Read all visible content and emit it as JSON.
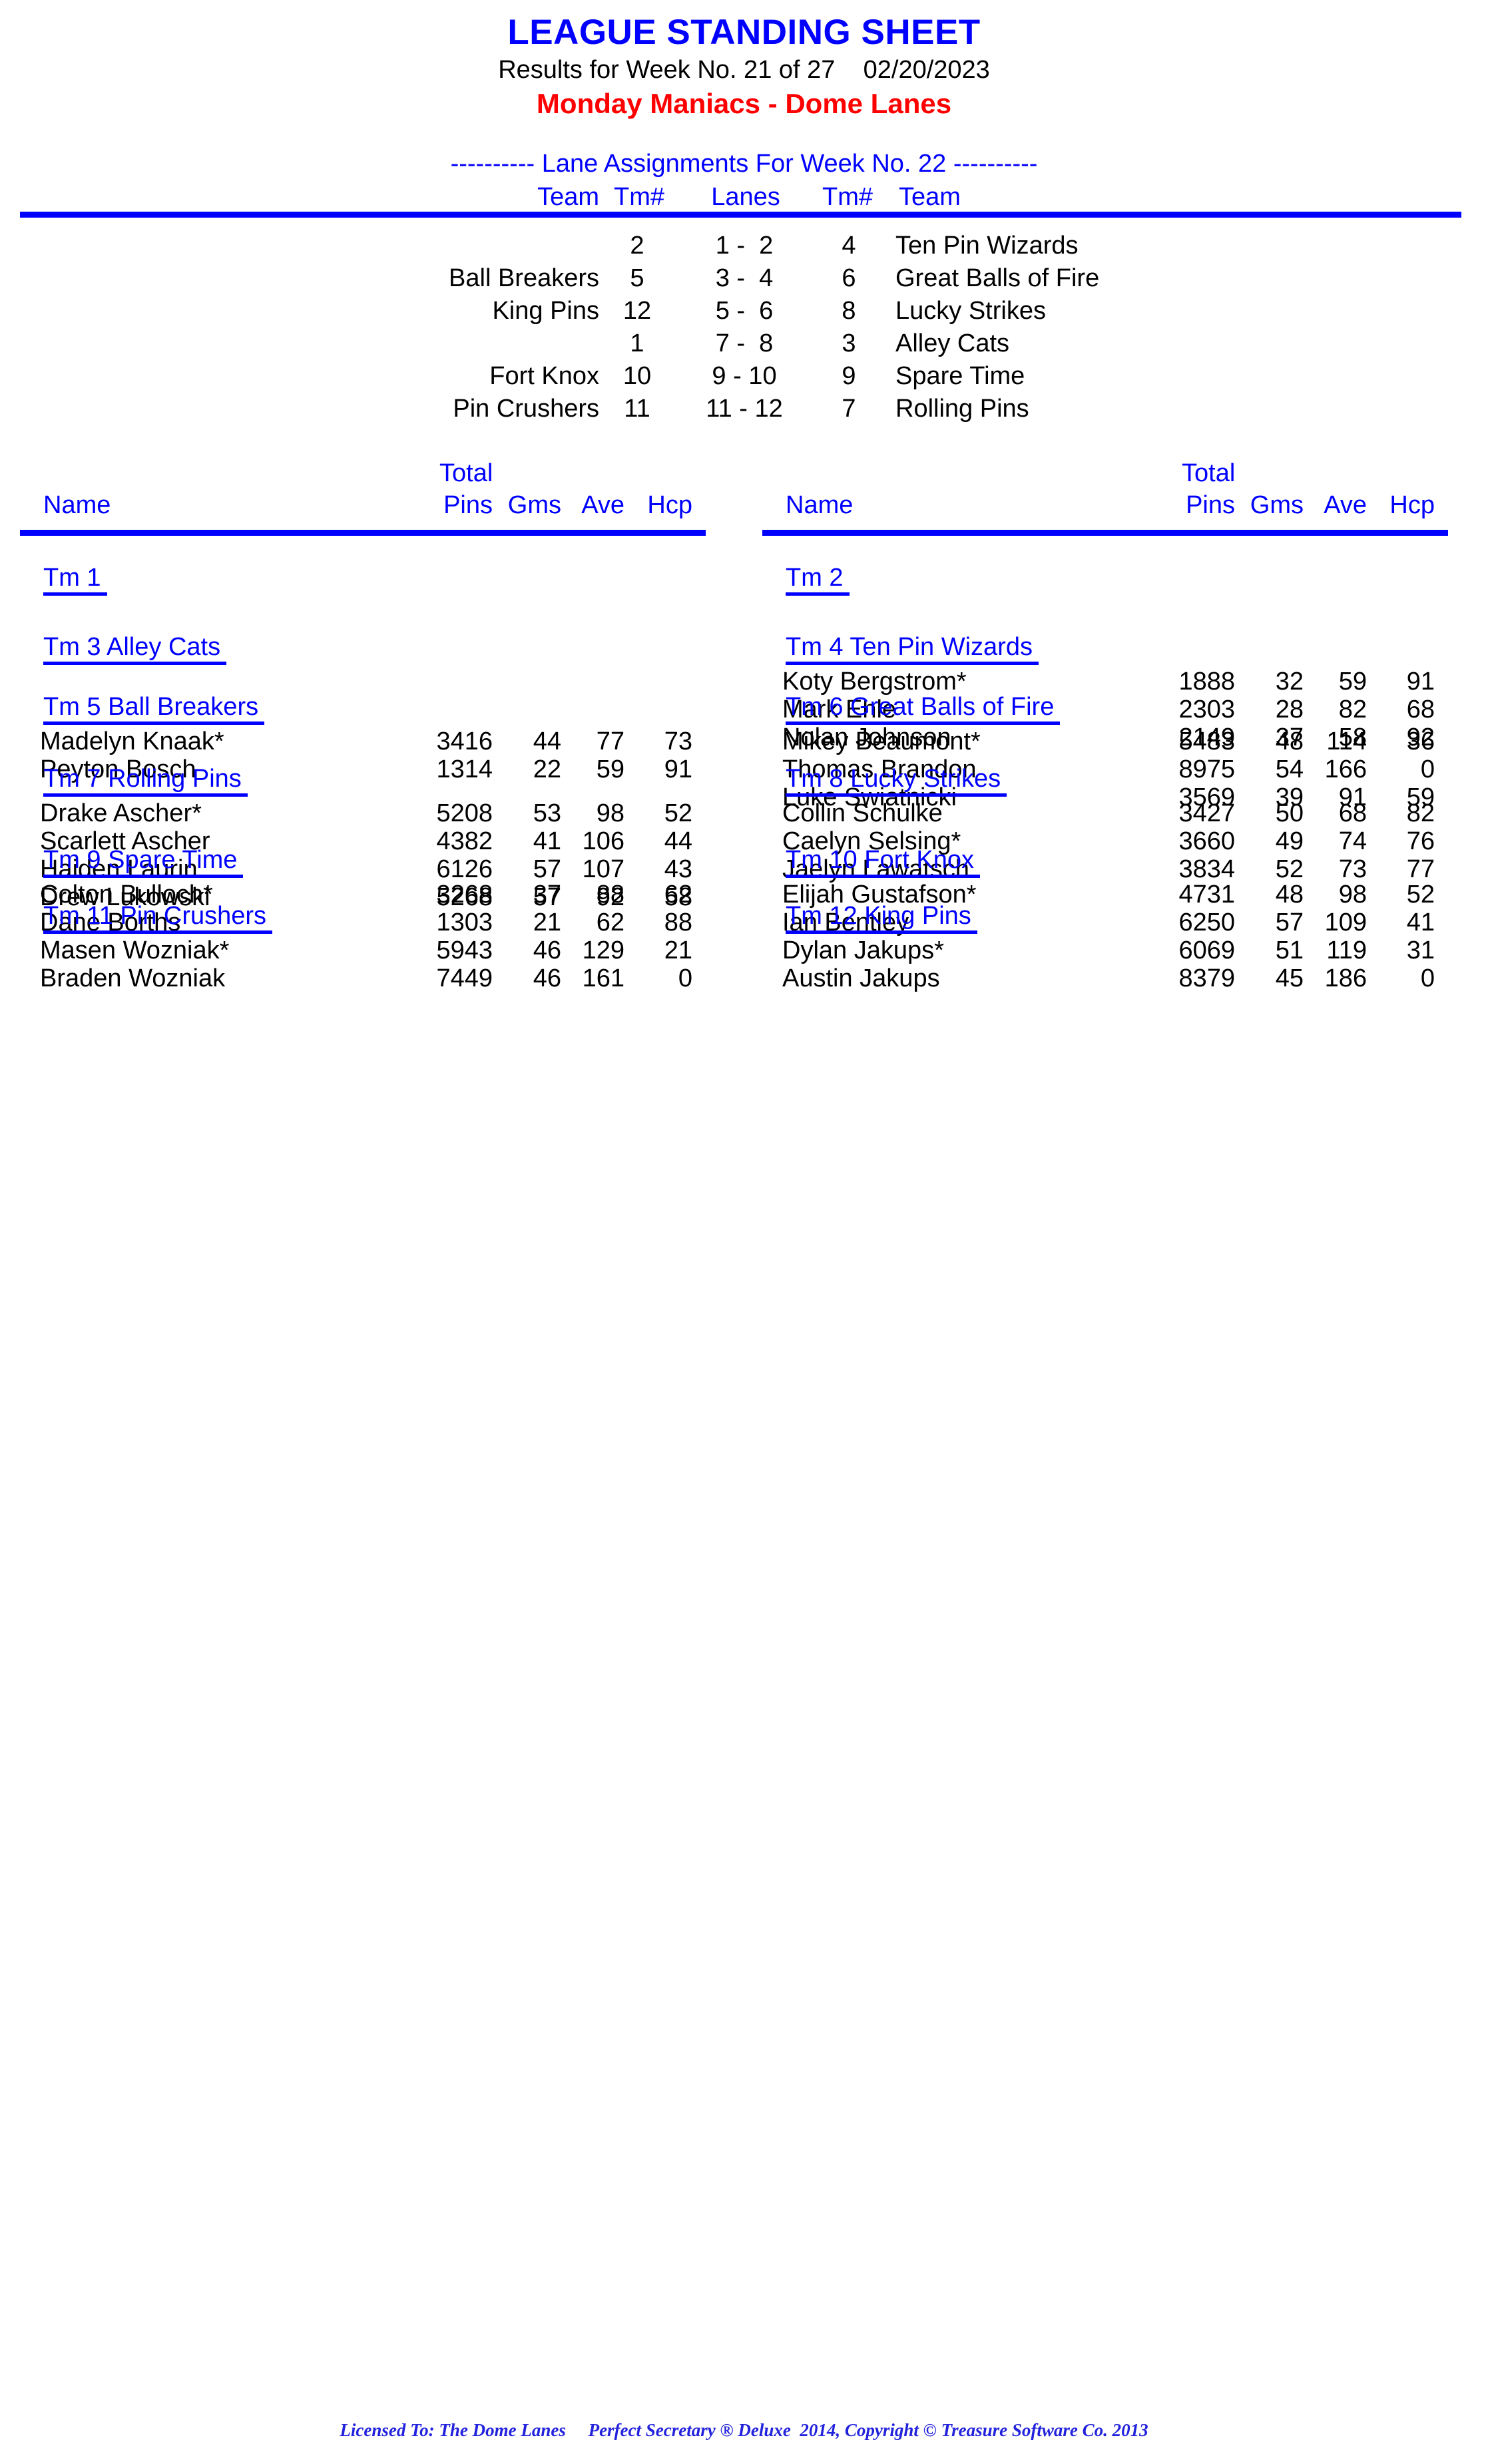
{
  "header": {
    "title": "LEAGUE STANDING SHEET",
    "results_line": "Results for Week No. 21 of 27    02/20/2023",
    "league_line": "Monday Maniacs - Dome Lanes",
    "title_color": "#0000ff",
    "league_color": "#ff0000"
  },
  "lane_assignments": {
    "heading": "---------- Lane Assignments For Week No. 22 ----------",
    "columns": {
      "team_left": "Team",
      "tm_num_left": "Tm#",
      "lanes": "Lanes",
      "tm_num_right": "Tm#",
      "team_right": "Team"
    },
    "rows": [
      {
        "team_left": "",
        "tm_left": "2",
        "lanes": "1 -  2",
        "tm_right": "4",
        "team_right": "Ten Pin Wizards"
      },
      {
        "team_left": "Ball Breakers",
        "tm_left": "5",
        "lanes": "3 -  4",
        "tm_right": "6",
        "team_right": "Great Balls of Fire"
      },
      {
        "team_left": "King Pins",
        "tm_left": "12",
        "lanes": "5 -  6",
        "tm_right": "8",
        "team_right": "Lucky Strikes"
      },
      {
        "team_left": "",
        "tm_left": "1",
        "lanes": "7 -  8",
        "tm_right": "3",
        "team_right": "Alley Cats"
      },
      {
        "team_left": "Fort Knox",
        "tm_left": "10",
        "lanes": "9 - 10",
        "tm_right": "9",
        "team_right": "Spare Time"
      },
      {
        "team_left": "Pin Crushers",
        "tm_left": "11",
        "lanes": "11 - 12",
        "tm_right": "7",
        "team_right": "Rolling Pins"
      }
    ]
  },
  "standings": {
    "column_headers": {
      "name": "Name",
      "total": "Total",
      "pins": "Pins",
      "gms": "Gms",
      "ave": "Ave",
      "hcp": "Hcp"
    },
    "left_column": [
      {
        "title": "Tm 1",
        "players": []
      },
      {
        "title": "Tm 3 Alley Cats",
        "players": []
      },
      {
        "title": "Tm 5 Ball Breakers",
        "players": [
          {
            "name": "Madelyn Knaak*",
            "pins": "3416",
            "gms": "44",
            "ave": "77",
            "hcp": "73"
          },
          {
            "name": "Peyton Bosch",
            "pins": "1314",
            "gms": "22",
            "ave": "59",
            "hcp": "91"
          }
        ]
      },
      {
        "title": "Tm 7 Rolling Pins",
        "players": [
          {
            "name": "Drake Ascher*",
            "pins": "5208",
            "gms": "53",
            "ave": "98",
            "hcp": "52"
          },
          {
            "name": "Scarlett Ascher",
            "pins": "4382",
            "gms": "41",
            "ave": "106",
            "hcp": "44"
          },
          {
            "name": "Haiden Laurin",
            "pins": "6126",
            "gms": "57",
            "ave": "107",
            "hcp": "43"
          },
          {
            "name": "Drew Lukowski",
            "pins": "5268",
            "gms": "57",
            "ave": "92",
            "hcp": "58"
          }
        ]
      },
      {
        "title": "Tm 9 Spare Time",
        "players": [
          {
            "name": "Colton Bulloch*",
            "pins": "3268",
            "gms": "37",
            "ave": "88",
            "hcp": "62"
          },
          {
            "name": "Dane Borths",
            "pins": "1303",
            "gms": "21",
            "ave": "62",
            "hcp": "88"
          }
        ]
      },
      {
        "title": "Tm 11 Pin Crushers",
        "players": [
          {
            "name": "Masen Wozniak*",
            "pins": "5943",
            "gms": "46",
            "ave": "129",
            "hcp": "21"
          },
          {
            "name": "Braden Wozniak",
            "pins": "7449",
            "gms": "46",
            "ave": "161",
            "hcp": "0"
          }
        ]
      }
    ],
    "right_column": [
      {
        "title": "Tm 2",
        "players": []
      },
      {
        "title": "Tm 4 Ten Pin Wizards",
        "players": [
          {
            "name": "Koty Bergstrom*",
            "pins": "1888",
            "gms": "32",
            "ave": "59",
            "hcp": "91"
          },
          {
            "name": "Mark Ehle",
            "pins": "2303",
            "gms": "28",
            "ave": "82",
            "hcp": "68"
          },
          {
            "name": "Nolan Johnson",
            "pins": "2149",
            "gms": "37",
            "ave": "58",
            "hcp": "92"
          }
        ]
      },
      {
        "title": "Tm 6 Great Balls of Fire",
        "players": [
          {
            "name": "Mikey Beaumont*",
            "pins": "5483",
            "gms": "48",
            "ave": "114",
            "hcp": "36"
          },
          {
            "name": "Thomas Brandon",
            "pins": "8975",
            "gms": "54",
            "ave": "166",
            "hcp": "0"
          },
          {
            "name": "Luke Swiatnicki",
            "pins": "3569",
            "gms": "39",
            "ave": "91",
            "hcp": "59"
          }
        ]
      },
      {
        "title": "Tm 8 Lucky Strikes",
        "players": [
          {
            "name": "Collin Schulke",
            "pins": "3427",
            "gms": "50",
            "ave": "68",
            "hcp": "82"
          },
          {
            "name": "Caelyn Selsing*",
            "pins": "3660",
            "gms": "49",
            "ave": "74",
            "hcp": "76"
          },
          {
            "name": "Jaelyn Lawatsch",
            "pins": "3834",
            "gms": "52",
            "ave": "73",
            "hcp": "77"
          }
        ]
      },
      {
        "title": "Tm 10 Fort Knox",
        "players": [
          {
            "name": "Elijah Gustafson*",
            "pins": "4731",
            "gms": "48",
            "ave": "98",
            "hcp": "52"
          },
          {
            "name": "Ian Bentley",
            "pins": "6250",
            "gms": "57",
            "ave": "109",
            "hcp": "41"
          }
        ]
      },
      {
        "title": "Tm 12 King Pins",
        "players": [
          {
            "name": "Dylan Jakups*",
            "pins": "6069",
            "gms": "51",
            "ave": "119",
            "hcp": "31"
          },
          {
            "name": "Austin Jakups",
            "pins": "8379",
            "gms": "45",
            "ave": "186",
            "hcp": "0"
          }
        ]
      }
    ]
  },
  "footer": {
    "text": "Licensed To: The Dome Lanes     Perfect Secretary ® Deluxe  2014, Copyright © Treasure Software Co. 2013"
  }
}
